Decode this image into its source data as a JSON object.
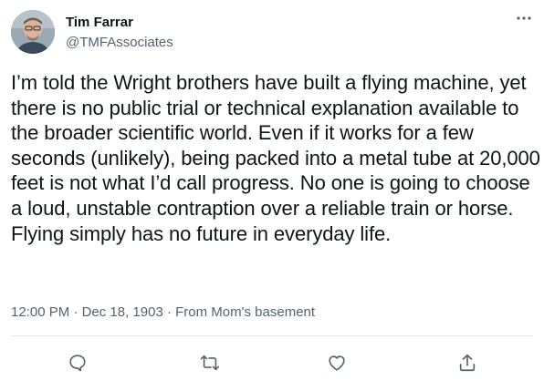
{
  "author": {
    "name": "Tim Farrar",
    "handle": "@TMFAssociates"
  },
  "tweet": {
    "text": "I’m told the Wright brothers have built a flying machine, yet there is no public trial or technical explanation available to the broader scientific world. Even if it works for a few seconds (unlikely), being packed into a metal tube at 20,000 feet is not what I’d call progress. No one is going to choose a loud, unstable contraption over a reliable train or horse. Flying simply has no future in everyday life."
  },
  "meta": {
    "time": "12:00 PM",
    "separator1": " · ",
    "date": "Dec 18, 1903",
    "separator2": " · ",
    "source": "From Mom's basement"
  },
  "icons": {
    "more": "more-horizontal-icon",
    "reply": "reply-icon",
    "retweet": "retweet-icon",
    "like": "like-icon",
    "share": "share-icon"
  },
  "colors": {
    "text": "#0f1419",
    "secondary": "#536471",
    "divider": "#e1e8ed"
  }
}
